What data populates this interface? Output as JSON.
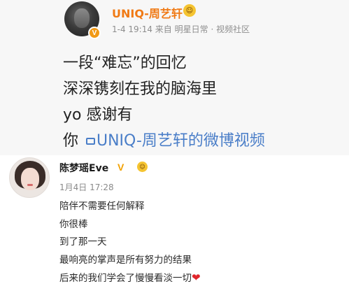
{
  "post": {
    "username": "UNIQ-周艺轩",
    "verified_badge": "V",
    "emoji_icon": "face-emoji-icon",
    "meta": "1-4 19:14  来自 明星日常 · 视频社区",
    "lines": [
      "一段“难忘”的回忆",
      "深深镌刻在我的脑海里",
      "yo 感谢有"
    ],
    "last_line_prefix": "你 ",
    "video_link": "UNIQ-周艺轩的微博视频"
  },
  "comment": {
    "username": "陈梦瑶Eve",
    "vip_badge": "V",
    "time": "1月4日  17:28",
    "lines": [
      "陪伴不需要任何解释",
      "你很棒",
      "到了那一天",
      "最响亮的掌声是所有努力的结果"
    ],
    "last_line": "后来的我们学会了慢慢看淡一切",
    "heart": "❤"
  },
  "colors": {
    "username_orange": "#f07a15",
    "link_blue": "#4a7ec8",
    "heart_red": "#e0262b"
  }
}
